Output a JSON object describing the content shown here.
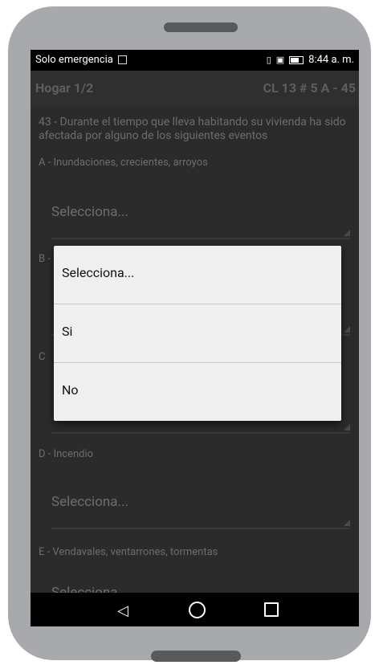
{
  "status_bar": {
    "carrier": "Solo emergencia",
    "time": "8:44 a. m."
  },
  "app_bar": {
    "title": "Hogar 1/2",
    "address": "CL 13 # 5 A - 45"
  },
  "question": "43 - Durante el tiempo que lleva habitando su vivienda ha sido afectada por alguno de los siguientes eventos",
  "items": [
    {
      "label": "A - Inundaciones, crecientes, arroyos",
      "value": "Selecciona..."
    },
    {
      "label": "B -",
      "value": ""
    },
    {
      "label": "C",
      "value": ""
    },
    {
      "label": "D - Incendio",
      "value": "Selecciona..."
    },
    {
      "label": "E - Vendavales, ventarrones, tormentas",
      "value": "Selecciona"
    }
  ],
  "dialog": {
    "options": [
      "Selecciona...",
      "Si",
      "No"
    ]
  },
  "icons": {
    "back": "back-triangle-icon",
    "home": "home-circle-icon",
    "recent": "recent-square-icon"
  },
  "colors": {
    "phone_body": "#a7a9ac",
    "screen_bg": "#2b2b2b",
    "dialog_bg": "#efefef"
  }
}
